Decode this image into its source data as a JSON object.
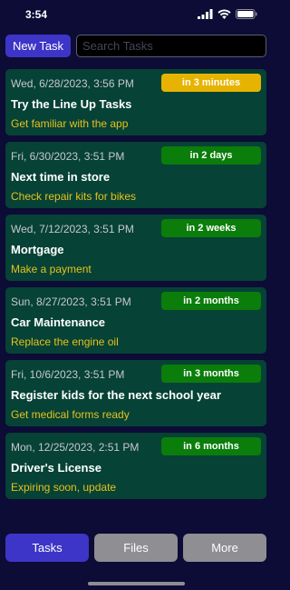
{
  "status_bar": {
    "time": "3:54"
  },
  "toolbar": {
    "new_task_label": "New Task",
    "search_placeholder": "Search Tasks",
    "search_value": ""
  },
  "tasks": [
    {
      "date": "Wed, 6/28/2023, 3:56 PM",
      "badge": "in 3 minutes",
      "badge_color": "#e6b400",
      "title": "Try the Line Up Tasks",
      "subtitle": "Get familiar with the app"
    },
    {
      "date": "Fri, 6/30/2023, 3:51 PM",
      "badge": "in 2 days",
      "badge_color": "#0a7d0a",
      "title": "Next time in store",
      "subtitle": "Check repair kits for bikes"
    },
    {
      "date": "Wed, 7/12/2023, 3:51 PM",
      "badge": "in 2 weeks",
      "badge_color": "#0a7d0a",
      "title": "Mortgage",
      "subtitle": "Make a payment"
    },
    {
      "date": "Sun, 8/27/2023, 3:51 PM",
      "badge": "in 2 months",
      "badge_color": "#0a7d0a",
      "title": "Car Maintenance",
      "subtitle": "Replace the engine oil"
    },
    {
      "date": "Fri, 10/6/2023, 3:51 PM",
      "badge": "in 3 months",
      "badge_color": "#0a7d0a",
      "title": "Register kids for the next school year",
      "subtitle": "Get medical forms ready"
    },
    {
      "date": "Mon, 12/25/2023, 2:51 PM",
      "badge": "in 6 months",
      "badge_color": "#0a7d0a",
      "title": "Driver's License",
      "subtitle": "Expiring soon, update"
    }
  ],
  "tabs": [
    {
      "label": "Tasks",
      "color": "#3d35c7",
      "active": true
    },
    {
      "label": "Files",
      "color": "#8e8e93",
      "active": false
    },
    {
      "label": "More",
      "color": "#8e8e93",
      "active": false
    }
  ],
  "colors": {
    "background": "#0c0c36",
    "card": "#064236",
    "accent": "#3d35c7",
    "subtitle": "#e5c21b"
  }
}
